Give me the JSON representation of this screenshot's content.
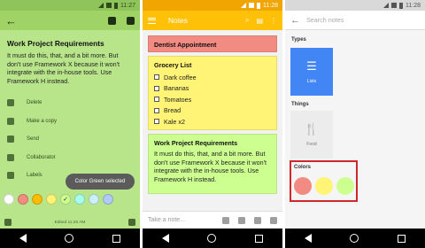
{
  "screen1": {
    "status_time": "11:27",
    "note": {
      "title": "Work Project Requirements",
      "body": "It must do this, that, and a bit more. But don't use Framework X because it won't integrate with the in-house tools. Use Framework H instead."
    },
    "menu": [
      "Delete",
      "Make a copy",
      "Send",
      "Collaborator",
      "Labels"
    ],
    "toast": "Color Green selected",
    "swatch_colors": [
      "#ffffff",
      "#f28b82",
      "#fbbc04",
      "#fff475",
      "#ccff90",
      "#a7ffeb",
      "#cbf0f8",
      "#aecbfa"
    ],
    "selected_check": "✓",
    "edited": "Edited 11:26 AM"
  },
  "screen2": {
    "status_time": "11:28",
    "title": "Notes",
    "cards": {
      "dentist": {
        "title": "Dentist Appointment",
        "color": "#f28b82"
      },
      "grocery": {
        "title": "Grocery List",
        "color": "#fff475",
        "items": [
          "Dark coffee",
          "Bananas",
          "Tomatoes",
          "Bread",
          "Kale x2"
        ]
      },
      "work": {
        "title": "Work Project Requirements",
        "color": "#ccff90",
        "body": "It must do this, that, and a bit more. But don't use Framework X because it won't integrate with the in-house tools. Use Framework H instead."
      }
    },
    "bottom_placeholder": "Take a note..."
  },
  "screen3": {
    "status_time": "11:28",
    "search_placeholder": "Search notes",
    "types_label": "Types",
    "tile_lists": "Lists",
    "things_label": "Things",
    "tile_food": "Food",
    "colors_label": "Colors",
    "color_swatches": [
      "#f28b82",
      "#fff475",
      "#ccff90"
    ],
    "accent": "#4285f4"
  }
}
